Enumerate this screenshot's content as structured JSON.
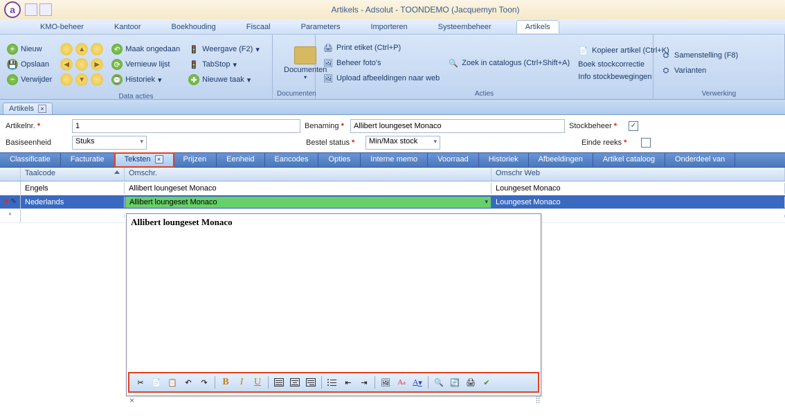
{
  "title": "Artikels - Adsolut - TOONDEMO (Jacquemyn Toon)",
  "menubar": [
    "KMO-beheer",
    "Kantoor",
    "Boekhouding",
    "Fiscaal",
    "Parameters",
    "Importeren",
    "Systeembeheer",
    "Artikels"
  ],
  "menubar_active_index": 7,
  "ribbon": {
    "data_acties": {
      "label": "Data acties",
      "nieuw": "Nieuw",
      "opslaan": "Opslaan",
      "verwijder": "Verwijder",
      "maak_ongedaan": "Maak ongedaan",
      "vernieuw_lijst": "Vernieuw lijst",
      "historiek": "Historiek",
      "weergave": "Weergave (F2)",
      "tabstop": "TabStop",
      "nieuwe_taak": "Nieuwe taak"
    },
    "documenten": {
      "label": "Documenten",
      "documenten": "Documenten"
    },
    "acties": {
      "label": "Acties",
      "print_etiket": "Print etiket (Ctrl+P)",
      "beheer_fotos": "Beheer foto's",
      "upload_afbeeldingen": "Upload afbeeldingen naar web",
      "zoek_in_catalogus": "Zoek in catalogus (Ctrl+Shift+A)",
      "kopieer_artikel": "Kopieer artikel (Ctrl+K)",
      "boek_stockcorrectie": "Boek stockcorrectie",
      "info_stockbewegingen": "Info stockbewegingen"
    },
    "verwerking": {
      "label": "Verwerking",
      "samenstelling": "Samenstelling (F8)",
      "varianten": "Varianten"
    }
  },
  "doc_tab": "Artikels",
  "form": {
    "artikelnr_label": "Artikelnr.",
    "artikelnr": "1",
    "benaming_label": "Benaming",
    "benaming": "Allibert loungeset Monaco",
    "stockbeheer_label": "Stockbeheer",
    "stockbeheer_checked": true,
    "basiseenheid_label": "Basiseenheid",
    "basiseenheid": "Stuks",
    "bestel_status_label": "Bestel status",
    "bestel_status": "Min/Max stock",
    "einde_reeks_label": "Einde reeks",
    "einde_reeks_checked": false
  },
  "subtabs": [
    "Classificatie",
    "Facturatie",
    "Teksten",
    "Prijzen",
    "Eenheid",
    "Eancodes",
    "Opties",
    "Interne memo",
    "Voorraad",
    "Historiek",
    "Afbeeldingen",
    "Artikel cataloog",
    "Onderdeel van"
  ],
  "subtab_active": "Teksten",
  "grid": {
    "headers": {
      "taalcode": "Taalcode",
      "omschr": "Omschr.",
      "omschr_web": "Omschr Web"
    },
    "rows": [
      {
        "taalcode": "Engels",
        "omschr": "Allibert loungeset Monaco",
        "omschr_web": "Loungeset Monaco"
      },
      {
        "taalcode": "Nederlands",
        "omschr": "Allibert loungeset Monaco",
        "omschr_web": "Loungeset Monaco"
      }
    ]
  },
  "editor_text": "Allibert loungeset Monaco",
  "editor_toolbar": {
    "cut": "Cut",
    "copy": "Copy",
    "paste": "Paste",
    "undo": "Undo",
    "redo": "Redo",
    "bold": "B",
    "italic": "I",
    "underline": "U",
    "align_left": "AlignLeft",
    "align_center": "AlignCenter",
    "align_right": "AlignRight",
    "bullets": "Bullets",
    "outdent": "Outdent",
    "indent": "Indent",
    "image": "Image",
    "fontsize": "A",
    "fontcolor": "A",
    "find": "Find",
    "replace": "Replace",
    "print": "Print",
    "spell": "Spell"
  }
}
